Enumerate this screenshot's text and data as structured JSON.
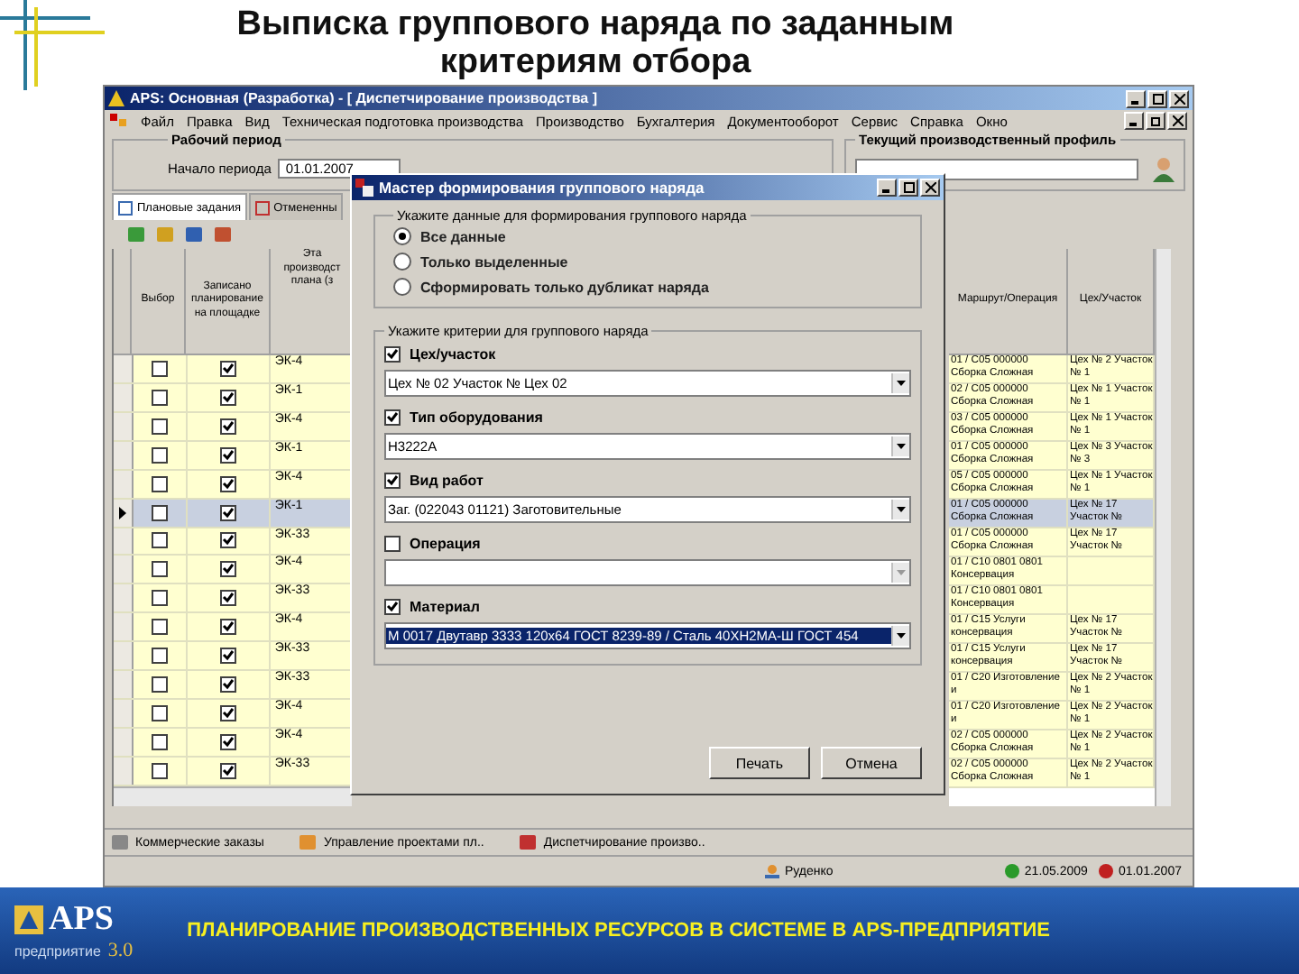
{
  "slide": {
    "title": "Выписка группового наряда по заданным критериям отбора",
    "footer": "ПЛАНИРОВАНИЕ ПРОИЗВОДСТВЕННЫХ РЕСУРСОВ В СИСТЕМЕ В APS-ПРЕДПРИЯТИЕ",
    "logo": {
      "name": "APS",
      "sub": "предприятие",
      "version": "3.0"
    }
  },
  "app": {
    "title": "APS: Основная (Разработка) - [ Диспетчирование производства ]",
    "menu": [
      "Файл",
      "Правка",
      "Вид",
      "Техническая подготовка производства",
      "Производство",
      "Бухгалтерия",
      "Документооборот",
      "Сервис",
      "Справка",
      "Окно"
    ],
    "work_period": {
      "legend": "Рабочий период",
      "label": "Начало периода",
      "value": "01.01.2007"
    },
    "profile": {
      "legend": "Текущий производственный профиль"
    },
    "tabs": [
      {
        "label": "Плановые задания",
        "selected": true
      },
      {
        "label": "Отмененны",
        "selected": false
      }
    ],
    "table": {
      "columns_left": [
        "Выбор",
        "Записано планирование на площадке",
        "Эта производст плана (з"
      ],
      "columns_right": [
        "Маршрут/Операция",
        "Цех/Участок"
      ],
      "rows": [
        {
          "selected": false,
          "pick": false,
          "recorded": true,
          "stage": "ЭК-4",
          "route": "01 / С05 000000 Сборка Сложная",
          "shop": "Цех № 2 Участок № 1"
        },
        {
          "selected": false,
          "pick": false,
          "recorded": true,
          "stage": "ЭК-1",
          "route": "02 / С05 000000 Сборка Сложная",
          "shop": "Цех № 1 Участок № 1"
        },
        {
          "selected": false,
          "pick": false,
          "recorded": true,
          "stage": "ЭК-4",
          "route": "03 / С05 000000 Сборка Сложная",
          "shop": "Цех № 1 Участок № 1"
        },
        {
          "selected": false,
          "pick": false,
          "recorded": true,
          "stage": "ЭК-1",
          "route": "01 / С05 000000 Сборка Сложная",
          "shop": "Цех № 3 Участок № 3"
        },
        {
          "selected": false,
          "pick": false,
          "recorded": true,
          "stage": "ЭК-4",
          "route": "05 / С05 000000 Сборка Сложная",
          "shop": "Цех № 1 Участок № 1"
        },
        {
          "selected": true,
          "pick": false,
          "recorded": true,
          "stage": "ЭК-1",
          "route": "01 / С05 000000 Сборка Сложная",
          "shop": "Цех № 17 Участок №"
        },
        {
          "selected": false,
          "pick": false,
          "recorded": true,
          "stage": "ЭК-33",
          "route": "01 / С05 000000 Сборка Сложная",
          "shop": "Цех № 17 Участок №"
        },
        {
          "selected": false,
          "pick": false,
          "recorded": true,
          "stage": "ЭК-4",
          "route": "01 / С10 0801 0801 Консервация",
          "shop": ""
        },
        {
          "selected": false,
          "pick": false,
          "recorded": true,
          "stage": "ЭК-33",
          "route": "01 / С10 0801 0801 Консервация",
          "shop": ""
        },
        {
          "selected": false,
          "pick": false,
          "recorded": true,
          "stage": "ЭК-4",
          "route": "01 / С15 Услуги консервация",
          "shop": "Цех № 17 Участок №"
        },
        {
          "selected": false,
          "pick": false,
          "recorded": true,
          "stage": "ЭК-33",
          "route": "01 / С15 Услуги консервация",
          "shop": "Цех № 17 Участок №"
        },
        {
          "selected": false,
          "pick": false,
          "recorded": true,
          "stage": "ЭК-33",
          "route": "01 / С20 Изготовление и",
          "shop": "Цех № 2 Участок № 1"
        },
        {
          "selected": false,
          "pick": false,
          "recorded": true,
          "stage": "ЭК-4",
          "route": "01 / С20 Изготовление и",
          "shop": "Цех № 2 Участок № 1"
        },
        {
          "selected": false,
          "pick": false,
          "recorded": true,
          "stage": "ЭК-4",
          "route": "02 / С05 000000 Сборка Сложная",
          "shop": "Цех № 2 Участок № 1"
        },
        {
          "selected": false,
          "pick": false,
          "recorded": true,
          "stage": "ЭК-33",
          "route": "02 / С05 000000 Сборка Сложная",
          "shop": "Цех № 2 Участок № 1"
        }
      ]
    },
    "taskbar": [
      "Коммерческие заказы",
      "Управление проектами пл..",
      "Диспетчирование произво.."
    ],
    "status": {
      "user": "Руденко",
      "date_ok": "21.05.2009",
      "date_stop": "01.01.2007"
    }
  },
  "dialog": {
    "title": "Мастер формирования группового наряда",
    "data_group": {
      "legend": "Укажите данные для формирования группового наряда",
      "options": [
        {
          "label": "Все данные",
          "selected": true
        },
        {
          "label": "Только выделенные",
          "selected": false
        },
        {
          "label": "Сформировать только дубликат наряда",
          "selected": false
        }
      ]
    },
    "criteria_group": {
      "legend": "Укажите критерии для группового наряда",
      "items": [
        {
          "label": "Цех/участок",
          "checked": true,
          "value": "Цех № 02 Участок №    Цех 02",
          "highlighted": false
        },
        {
          "label": "Тип оборудования",
          "checked": true,
          "value": "Н3222А",
          "highlighted": false
        },
        {
          "label": "Вид работ",
          "checked": true,
          "value": "Заг. (022043 01121) Заготовительные",
          "highlighted": false
        },
        {
          "label": "Операция",
          "checked": false,
          "highlighted": false
        },
        {
          "label": "Материал",
          "checked": true,
          "value": "М 0017  Двутавр 3333 120х64 ГОСТ 8239-89 / Сталь 40ХН2МА-Ш  ГОСТ 454",
          "highlighted": true
        }
      ]
    },
    "buttons": [
      "Печать",
      "Отмена"
    ]
  }
}
